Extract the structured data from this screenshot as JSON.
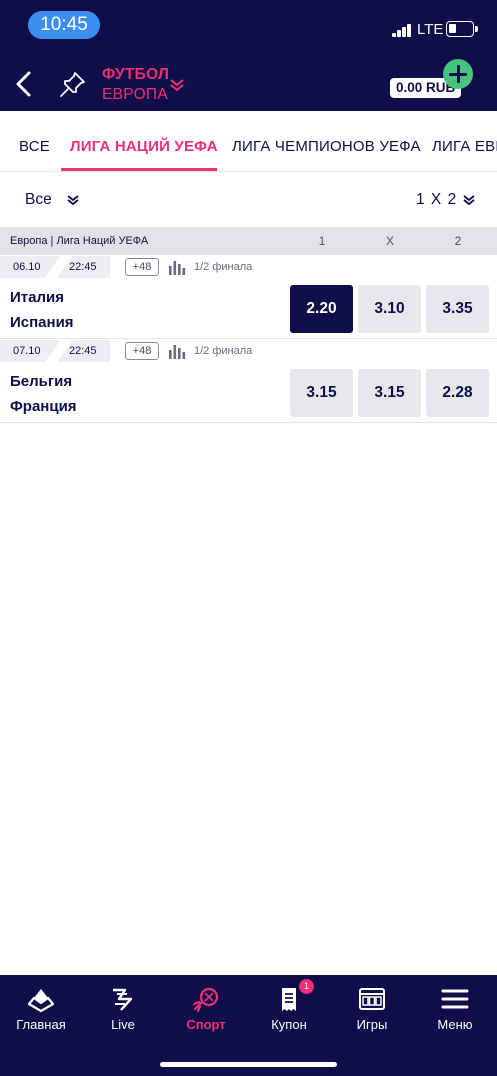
{
  "status_bar": {
    "time": "10:45",
    "network": "LTE"
  },
  "header": {
    "title": "ФУТБОЛ",
    "subtitle": "ЕВРОПА",
    "balance": "0.00 RUB"
  },
  "tabs": [
    {
      "label": "ВСЕ",
      "active": false
    },
    {
      "label": "ЛИГА НАЦИЙ УЕФА",
      "active": true
    },
    {
      "label": "ЛИГА ЧЕМПИОНОВ УЕФА",
      "active": false
    },
    {
      "label": "ЛИГА ЕВР",
      "active": false
    }
  ],
  "filter": {
    "left_label": "Все",
    "right_label": "1 X 2"
  },
  "league": {
    "name": "Европа | Лига Наций УЕФА",
    "columns": [
      "1",
      "X",
      "2"
    ]
  },
  "events": [
    {
      "date": "06.10",
      "time": "22:45",
      "more": "+48",
      "stage": "1/2 финала",
      "home": "Италия",
      "away": "Испания",
      "odds": [
        "2.20",
        "3.10",
        "3.35"
      ],
      "selected_index": 0
    },
    {
      "date": "07.10",
      "time": "22:45",
      "more": "+48",
      "stage": "1/2 финала",
      "home": "Бельгия",
      "away": "Франция",
      "odds": [
        "3.15",
        "3.15",
        "2.28"
      ],
      "selected_index": -1
    }
  ],
  "bottom_nav": [
    {
      "label": "Главная",
      "icon": "home-icon"
    },
    {
      "label": "Live",
      "icon": "live-icon"
    },
    {
      "label": "Спорт",
      "icon": "sport-icon",
      "active": true
    },
    {
      "label": "Купон",
      "icon": "coupon-icon",
      "badge": "1"
    },
    {
      "label": "Игры",
      "icon": "slots-icon"
    },
    {
      "label": "Меню",
      "icon": "menu-icon"
    }
  ],
  "colors": {
    "navy": "#0f0e4a",
    "accent": "#ef2f73",
    "add_green": "#46c37e",
    "time_pill": "#3c8ef0"
  }
}
